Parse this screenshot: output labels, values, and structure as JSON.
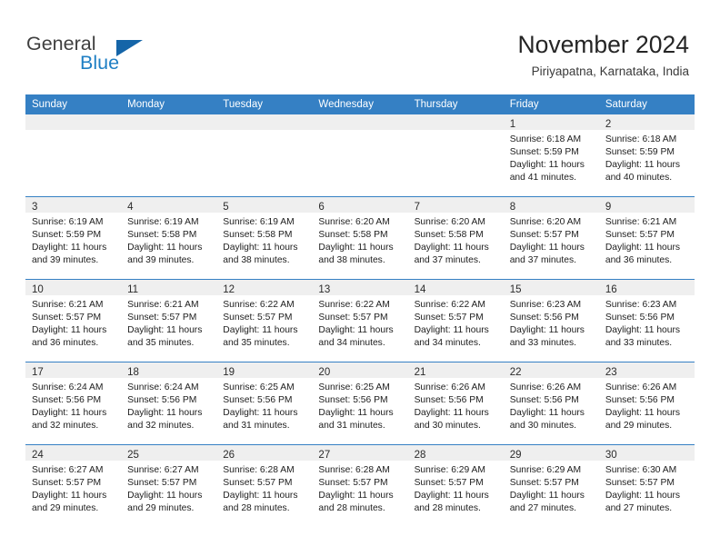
{
  "brand": {
    "name_part1": "General",
    "name_part2": "Blue",
    "triangle_icon": "triangle-logo-icon",
    "accent_color": "#1f7fc4",
    "header_color": "#3580c4"
  },
  "header": {
    "title": "November 2024",
    "subtitle": "Piriyapatna, Karnataka, India"
  },
  "weekday_headers": [
    "Sunday",
    "Monday",
    "Tuesday",
    "Wednesday",
    "Thursday",
    "Friday",
    "Saturday"
  ],
  "weeks": [
    [
      {
        "day": "",
        "lines": []
      },
      {
        "day": "",
        "lines": []
      },
      {
        "day": "",
        "lines": []
      },
      {
        "day": "",
        "lines": []
      },
      {
        "day": "",
        "lines": []
      },
      {
        "day": "1",
        "lines": [
          "Sunrise: 6:18 AM",
          "Sunset: 5:59 PM",
          "Daylight: 11 hours",
          "and 41 minutes."
        ]
      },
      {
        "day": "2",
        "lines": [
          "Sunrise: 6:18 AM",
          "Sunset: 5:59 PM",
          "Daylight: 11 hours",
          "and 40 minutes."
        ]
      }
    ],
    [
      {
        "day": "3",
        "lines": [
          "Sunrise: 6:19 AM",
          "Sunset: 5:59 PM",
          "Daylight: 11 hours",
          "and 39 minutes."
        ]
      },
      {
        "day": "4",
        "lines": [
          "Sunrise: 6:19 AM",
          "Sunset: 5:58 PM",
          "Daylight: 11 hours",
          "and 39 minutes."
        ]
      },
      {
        "day": "5",
        "lines": [
          "Sunrise: 6:19 AM",
          "Sunset: 5:58 PM",
          "Daylight: 11 hours",
          "and 38 minutes."
        ]
      },
      {
        "day": "6",
        "lines": [
          "Sunrise: 6:20 AM",
          "Sunset: 5:58 PM",
          "Daylight: 11 hours",
          "and 38 minutes."
        ]
      },
      {
        "day": "7",
        "lines": [
          "Sunrise: 6:20 AM",
          "Sunset: 5:58 PM",
          "Daylight: 11 hours",
          "and 37 minutes."
        ]
      },
      {
        "day": "8",
        "lines": [
          "Sunrise: 6:20 AM",
          "Sunset: 5:57 PM",
          "Daylight: 11 hours",
          "and 37 minutes."
        ]
      },
      {
        "day": "9",
        "lines": [
          "Sunrise: 6:21 AM",
          "Sunset: 5:57 PM",
          "Daylight: 11 hours",
          "and 36 minutes."
        ]
      }
    ],
    [
      {
        "day": "10",
        "lines": [
          "Sunrise: 6:21 AM",
          "Sunset: 5:57 PM",
          "Daylight: 11 hours",
          "and 36 minutes."
        ]
      },
      {
        "day": "11",
        "lines": [
          "Sunrise: 6:21 AM",
          "Sunset: 5:57 PM",
          "Daylight: 11 hours",
          "and 35 minutes."
        ]
      },
      {
        "day": "12",
        "lines": [
          "Sunrise: 6:22 AM",
          "Sunset: 5:57 PM",
          "Daylight: 11 hours",
          "and 35 minutes."
        ]
      },
      {
        "day": "13",
        "lines": [
          "Sunrise: 6:22 AM",
          "Sunset: 5:57 PM",
          "Daylight: 11 hours",
          "and 34 minutes."
        ]
      },
      {
        "day": "14",
        "lines": [
          "Sunrise: 6:22 AM",
          "Sunset: 5:57 PM",
          "Daylight: 11 hours",
          "and 34 minutes."
        ]
      },
      {
        "day": "15",
        "lines": [
          "Sunrise: 6:23 AM",
          "Sunset: 5:56 PM",
          "Daylight: 11 hours",
          "and 33 minutes."
        ]
      },
      {
        "day": "16",
        "lines": [
          "Sunrise: 6:23 AM",
          "Sunset: 5:56 PM",
          "Daylight: 11 hours",
          "and 33 minutes."
        ]
      }
    ],
    [
      {
        "day": "17",
        "lines": [
          "Sunrise: 6:24 AM",
          "Sunset: 5:56 PM",
          "Daylight: 11 hours",
          "and 32 minutes."
        ]
      },
      {
        "day": "18",
        "lines": [
          "Sunrise: 6:24 AM",
          "Sunset: 5:56 PM",
          "Daylight: 11 hours",
          "and 32 minutes."
        ]
      },
      {
        "day": "19",
        "lines": [
          "Sunrise: 6:25 AM",
          "Sunset: 5:56 PM",
          "Daylight: 11 hours",
          "and 31 minutes."
        ]
      },
      {
        "day": "20",
        "lines": [
          "Sunrise: 6:25 AM",
          "Sunset: 5:56 PM",
          "Daylight: 11 hours",
          "and 31 minutes."
        ]
      },
      {
        "day": "21",
        "lines": [
          "Sunrise: 6:26 AM",
          "Sunset: 5:56 PM",
          "Daylight: 11 hours",
          "and 30 minutes."
        ]
      },
      {
        "day": "22",
        "lines": [
          "Sunrise: 6:26 AM",
          "Sunset: 5:56 PM",
          "Daylight: 11 hours",
          "and 30 minutes."
        ]
      },
      {
        "day": "23",
        "lines": [
          "Sunrise: 6:26 AM",
          "Sunset: 5:56 PM",
          "Daylight: 11 hours",
          "and 29 minutes."
        ]
      }
    ],
    [
      {
        "day": "24",
        "lines": [
          "Sunrise: 6:27 AM",
          "Sunset: 5:57 PM",
          "Daylight: 11 hours",
          "and 29 minutes."
        ]
      },
      {
        "day": "25",
        "lines": [
          "Sunrise: 6:27 AM",
          "Sunset: 5:57 PM",
          "Daylight: 11 hours",
          "and 29 minutes."
        ]
      },
      {
        "day": "26",
        "lines": [
          "Sunrise: 6:28 AM",
          "Sunset: 5:57 PM",
          "Daylight: 11 hours",
          "and 28 minutes."
        ]
      },
      {
        "day": "27",
        "lines": [
          "Sunrise: 6:28 AM",
          "Sunset: 5:57 PM",
          "Daylight: 11 hours",
          "and 28 minutes."
        ]
      },
      {
        "day": "28",
        "lines": [
          "Sunrise: 6:29 AM",
          "Sunset: 5:57 PM",
          "Daylight: 11 hours",
          "and 28 minutes."
        ]
      },
      {
        "day": "29",
        "lines": [
          "Sunrise: 6:29 AM",
          "Sunset: 5:57 PM",
          "Daylight: 11 hours",
          "and 27 minutes."
        ]
      },
      {
        "day": "30",
        "lines": [
          "Sunrise: 6:30 AM",
          "Sunset: 5:57 PM",
          "Daylight: 11 hours",
          "and 27 minutes."
        ]
      }
    ]
  ]
}
